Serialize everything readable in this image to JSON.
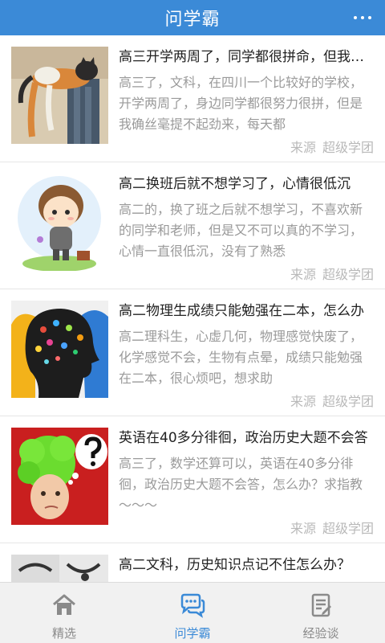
{
  "header": {
    "title": "问学霸",
    "more_icon": "more-dots-icon"
  },
  "articles": [
    {
      "title": "高三开学两周了，同学都很拼命，但我还是提不起劲",
      "summary": "高三了，文科，在四川一个比较好的学校，开学两周了，身边同学都很努力很拼，但是我确丝毫提不起劲来，每天都",
      "source_label": "来源",
      "source_name": "超级学团",
      "image": "cat-photo"
    },
    {
      "title": "高二换班后就不想学习了，心情很低沉",
      "summary": "高二的，换了班之后就不想学习，不喜欢新的同学和老师，但是又不可以真的不学习，心情一直很低沉，没有了熟悉",
      "source_label": "来源",
      "source_name": "超级学团",
      "image": "cartoon-boy"
    },
    {
      "title": "高二物理生成绩只能勉强在二本，怎么办",
      "summary": "高二理科生，心虚几何，物理感觉快废了，化学感觉不会，生物有点晕，成绩只能勉强在二本，很心烦吧，想求助",
      "source_label": "来源",
      "source_name": "超级学团",
      "image": "brain-heads"
    },
    {
      "title": "英语在40多分徘徊，政治历史大题不会答",
      "summary": "高三了，数学还算可以，英语在40多分徘徊，政治历史大题不会答，怎么办？求指教～～～",
      "source_label": "来源",
      "source_name": "超级学团",
      "image": "question-kid"
    },
    {
      "title": "高二文科，历史知识点记不住怎么办？",
      "summary": "",
      "source_label": "",
      "source_name": "",
      "image": "book-notes"
    }
  ],
  "tabs": [
    {
      "label": "精选",
      "icon": "home-icon",
      "active": false
    },
    {
      "label": "问学霸",
      "icon": "chat-bubbles-icon",
      "active": true
    },
    {
      "label": "经验谈",
      "icon": "notepad-icon",
      "active": false
    }
  ],
  "colors": {
    "accent": "#3b8ad7",
    "tab_inactive": "#8a8a8a"
  }
}
